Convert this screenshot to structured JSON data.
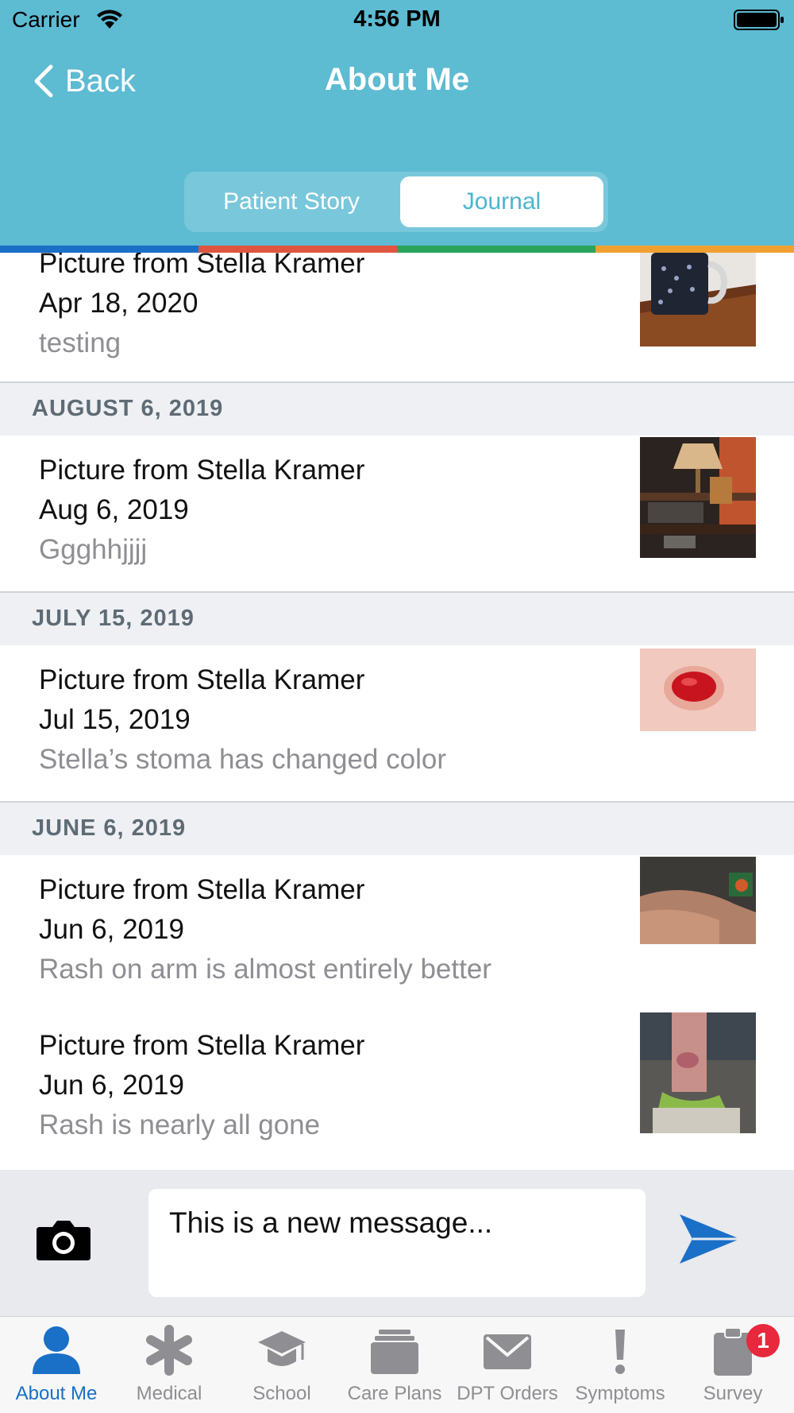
{
  "status_bar": {
    "carrier": "Carrier",
    "time": "4:56 PM"
  },
  "nav": {
    "back_label": "Back",
    "title": "About Me"
  },
  "segments": {
    "patient_story": "Patient Story",
    "journal": "Journal",
    "selected": "Journal"
  },
  "accent_colors": [
    "#1a6fc7",
    "#e0553f",
    "#2aa45c",
    "#f0a030"
  ],
  "entries_top": {
    "title": "Picture from Stella Kramer",
    "date": "Apr 18, 2020",
    "note": "testing"
  },
  "sections": [
    {
      "header": "AUGUST 6, 2019",
      "entries": [
        {
          "title": "Picture from Stella Kramer",
          "date": "Aug 6, 2019",
          "note": "Ggghhjjjj"
        }
      ]
    },
    {
      "header": "JULY 15, 2019",
      "entries": [
        {
          "title": "Picture from Stella Kramer",
          "date": "Jul 15, 2019",
          "note": "Stella’s stoma has changed color"
        }
      ]
    },
    {
      "header": "JUNE 6, 2019",
      "entries": [
        {
          "title": "Picture from Stella Kramer",
          "date": "Jun 6, 2019",
          "note": "Rash on arm is almost entirely better"
        },
        {
          "title": "Picture from Stella Kramer",
          "date": "Jun 6, 2019",
          "note": "Rash is nearly all gone"
        }
      ]
    }
  ],
  "compose": {
    "message_value": "This is a new message..."
  },
  "tabs": [
    {
      "label": "About Me",
      "icon": "person-icon",
      "active": true
    },
    {
      "label": "Medical",
      "icon": "asterisk-icon"
    },
    {
      "label": "School",
      "icon": "graduation-cap-icon"
    },
    {
      "label": "Care Plans",
      "icon": "folders-icon"
    },
    {
      "label": "DPT Orders",
      "icon": "envelope-icon"
    },
    {
      "label": "Symptoms",
      "icon": "exclamation-icon"
    },
    {
      "label": "Survey",
      "icon": "clipboard-icon",
      "badge": "1"
    }
  ]
}
